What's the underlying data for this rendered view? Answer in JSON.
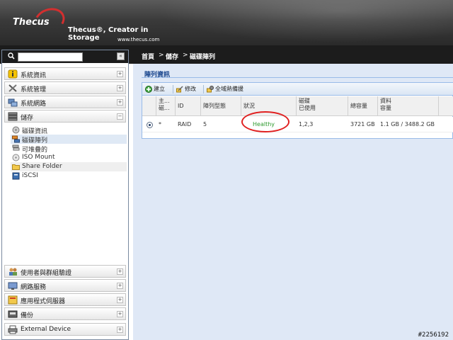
{
  "header": {
    "brand": "Thecus",
    "tagline": "Thecus®, Creator in Storage",
    "website": "www.thecus.com"
  },
  "search": {
    "placeholder": "",
    "collapse_label": "«"
  },
  "sidebar": {
    "categories": [
      {
        "label": "系統資訊",
        "icon": "info-icon",
        "toggle": "+"
      },
      {
        "label": "系統管理",
        "icon": "tools-icon",
        "toggle": "+"
      },
      {
        "label": "系統網路",
        "icon": "network-icon",
        "toggle": "+"
      },
      {
        "label": "儲存",
        "icon": "storage-icon",
        "toggle": "−"
      },
      {
        "label": "使用者與群組驗證",
        "icon": "users-icon",
        "toggle": "+"
      },
      {
        "label": "網路服務",
        "icon": "network-service-icon",
        "toggle": "+"
      },
      {
        "label": "應用程式伺服器",
        "icon": "app-server-icon",
        "toggle": "+"
      },
      {
        "label": "備份",
        "icon": "backup-icon",
        "toggle": "+"
      },
      {
        "label": "External Device",
        "icon": "printer-icon",
        "toggle": "+"
      }
    ],
    "storage_items": [
      {
        "label": "磁碟資訊",
        "icon": "disk-icon"
      },
      {
        "label": "磁碟陣列",
        "icon": "raid-icon",
        "active": true
      },
      {
        "label": "可堆疊的",
        "icon": "stack-icon"
      },
      {
        "label": "ISO Mount",
        "icon": "iso-icon"
      },
      {
        "label": "Share Folder",
        "icon": "folder-icon"
      },
      {
        "label": "iSCSI",
        "icon": "iscsi-icon"
      }
    ]
  },
  "breadcrumb": {
    "home": "首頁",
    "sep": ">",
    "section": "儲存",
    "page": "磁碟陣列"
  },
  "panel": {
    "title": "陣列資訊",
    "toolbar": {
      "create": "建立",
      "edit": "修改",
      "global_hot_spare": "全域熱備援"
    },
    "columns": {
      "master": "主...\n磁...",
      "id": "ID",
      "raid_level": "陣列型態",
      "status": "狀況",
      "disks": "磁碟\n已使用",
      "total": "總容量",
      "data": "資料\n容量"
    },
    "rows": [
      {
        "master": "*",
        "id": "RAID",
        "raid_level": "5",
        "status": "Healthy",
        "disks": "1,2,3",
        "total": "3721 GB",
        "data": "1.1 GB / 3488.2 GB"
      }
    ]
  },
  "colors": {
    "accent": "#15428b",
    "healthy": "#2e9a2e",
    "highlight": "#e02020"
  },
  "watermark": "#2256192"
}
